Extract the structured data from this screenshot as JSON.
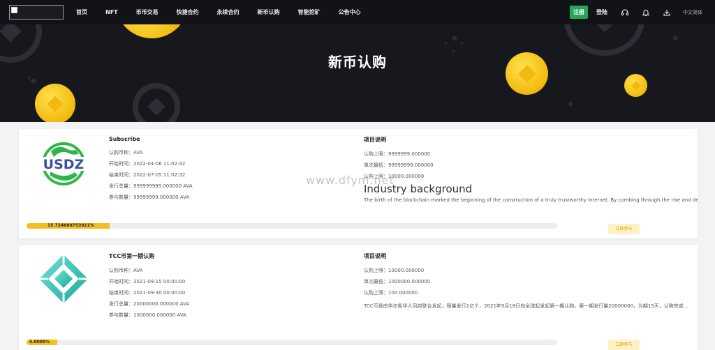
{
  "nav": {
    "links": [
      "首页",
      "NFT",
      "币币交易",
      "快捷合约",
      "永续合约",
      "新币认购",
      "智能挖矿",
      "公告中心"
    ],
    "register": "注册",
    "login": "登陆",
    "icons": [
      "headset-icon",
      "bell-icon",
      "download-icon"
    ],
    "language": "中文简体"
  },
  "hero": {
    "title": "新币认购"
  },
  "watermark": "www.dfym.net",
  "projects": [
    {
      "title": "Subscribe",
      "logo_text": "USDZ",
      "currency_label": "认购币种：",
      "currency": "AVA",
      "start_label": "开始时间：",
      "start": "2022-04-06 11:02:32",
      "end_label": "结束时间：",
      "end": "2022-07-05 11:02:32",
      "total_label": "发行总量：",
      "total": "999999999.000000 AVA",
      "participants_label": "参与数量：",
      "participants": "99999999.000000 AVA",
      "desc_title": "项目说明",
      "limit_label": "认购上限：",
      "limit": "9999999.000000",
      "min_label": "单次最低：",
      "min": "99999999.000000",
      "max_label": "认购上限：",
      "max": "10000.000000",
      "background_title": "Industry background",
      "description": "The birth of the blockchain marked the beginning of the construction of a truly trustworthy Internet. By combing through the rise and development of blockchain",
      "progress_text": "15.724660753921%",
      "progress": 0.157,
      "button": "立即参与",
      "accent": "#f2bf1f"
    },
    {
      "title": "TCC币第一期认购",
      "currency_label": "认购币种：",
      "currency": "AVA",
      "start_label": "开始时间：",
      "start": "2021-09-15 00:00:00",
      "end_label": "结束时间：",
      "end": "2021-09-30 00:00:00",
      "total_label": "发行总量：",
      "total": "20000000.000000 AVA",
      "participants_label": "参与数量：",
      "participants": "1000000.000000 AVA",
      "desc_title": "项目说明",
      "limit_label": "认购上限：",
      "limit": "10000.000000",
      "min_label": "单次最低：",
      "min": "1000000.000000",
      "max_label": "认购上限：",
      "max": "100.000000",
      "description": "TCC币是由华尔街华人风控联合发起，限量发行1亿个，2021年9月18日向全球起发起第一期认购，第一期发行量20000000，为期15天，认购完成后即可上线交易",
      "progress_text": "5.0000%",
      "progress": 0.058,
      "button": "立即参与",
      "accent": "#f2bf1f"
    }
  ]
}
